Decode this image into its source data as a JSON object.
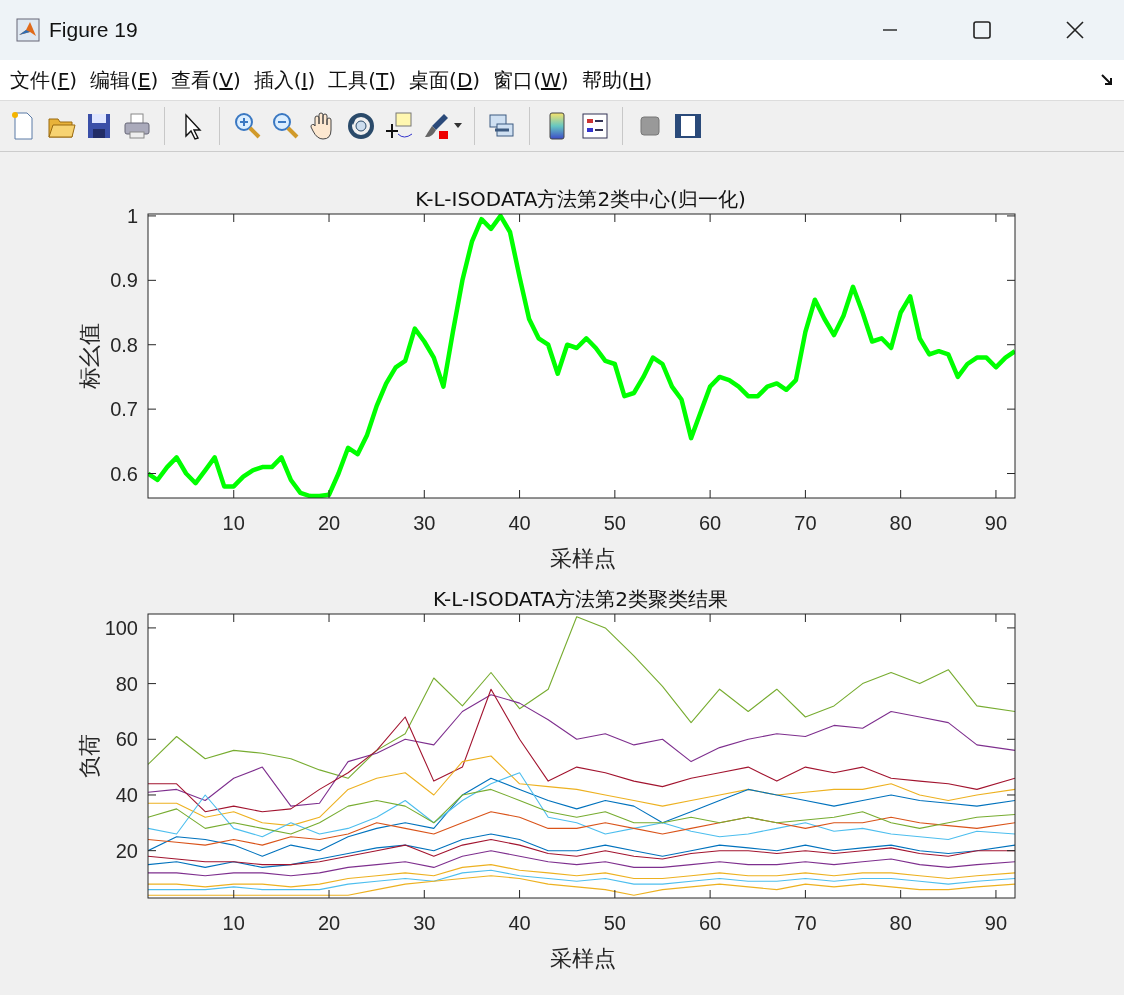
{
  "window": {
    "title": "Figure 19"
  },
  "menu": [
    "文件(F)",
    "编辑(E)",
    "查看(V)",
    "插入(I)",
    "工具(T)",
    "桌面(D)",
    "窗口(W)",
    "帮助(H)"
  ],
  "axes": [
    {
      "chart_data": {
        "type": "line",
        "title": "K-L-ISODATA方法第2类中心(归一化)",
        "xlabel": "采样点",
        "ylabel": "标幺值",
        "x": [
          1,
          2,
          3,
          4,
          5,
          6,
          7,
          8,
          9,
          10,
          11,
          12,
          13,
          14,
          15,
          16,
          17,
          18,
          19,
          20,
          21,
          22,
          23,
          24,
          25,
          26,
          27,
          28,
          29,
          30,
          31,
          32,
          33,
          34,
          35,
          36,
          37,
          38,
          39,
          40,
          41,
          42,
          43,
          44,
          45,
          46,
          47,
          48,
          49,
          50,
          51,
          52,
          53,
          54,
          55,
          56,
          57,
          58,
          59,
          60,
          61,
          62,
          63,
          64,
          65,
          66,
          67,
          68,
          69,
          70,
          71,
          72,
          73,
          74,
          75,
          76,
          77,
          78,
          79,
          80,
          81,
          82,
          83,
          84,
          85,
          86,
          87,
          88,
          89,
          90,
          91,
          92
        ],
        "xlim": [
          1,
          92
        ],
        "ylim": [
          0.562,
          1.003
        ],
        "xticks": [
          10,
          20,
          30,
          40,
          50,
          60,
          70,
          80,
          90
        ],
        "yticks": [
          0.6,
          0.7,
          0.8,
          0.9,
          1
        ],
        "series": [
          {
            "color": "#00ff00",
            "values": [
              0.6,
              0.59,
              0.61,
              0.625,
              0.6,
              0.585,
              0.605,
              0.625,
              0.58,
              0.58,
              0.595,
              0.605,
              0.61,
              0.61,
              0.625,
              0.59,
              0.57,
              0.565,
              0.565,
              0.567,
              0.6,
              0.64,
              0.63,
              0.66,
              0.705,
              0.74,
              0.765,
              0.775,
              0.825,
              0.805,
              0.78,
              0.735,
              0.82,
              0.9,
              0.96,
              0.995,
              0.98,
              1.0,
              0.975,
              0.905,
              0.84,
              0.81,
              0.8,
              0.755,
              0.8,
              0.795,
              0.81,
              0.795,
              0.775,
              0.77,
              0.72,
              0.725,
              0.75,
              0.78,
              0.77,
              0.735,
              0.715,
              0.655,
              0.695,
              0.735,
              0.75,
              0.745,
              0.735,
              0.72,
              0.72,
              0.735,
              0.74,
              0.73,
              0.745,
              0.82,
              0.87,
              0.84,
              0.815,
              0.845,
              0.89,
              0.85,
              0.805,
              0.81,
              0.795,
              0.85,
              0.875,
              0.81,
              0.785,
              0.79,
              0.785,
              0.75,
              0.77,
              0.78,
              0.78,
              0.765,
              0.78,
              0.79
            ]
          }
        ]
      }
    },
    {
      "chart_data": {
        "type": "line",
        "title": "K-L-ISODATA方法第2类聚类结果",
        "xlabel": "采样点",
        "ylabel": "负荷",
        "x": [
          1,
          4,
          7,
          10,
          13,
          16,
          19,
          22,
          25,
          28,
          31,
          34,
          37,
          40,
          43,
          46,
          49,
          52,
          55,
          58,
          61,
          64,
          67,
          70,
          73,
          76,
          79,
          82,
          85,
          88,
          92
        ],
        "xlim": [
          1,
          92
        ],
        "ylim": [
          3,
          105
        ],
        "xticks": [
          10,
          20,
          30,
          40,
          50,
          60,
          70,
          80,
          90
        ],
        "yticks": [
          20,
          40,
          60,
          80,
          100
        ],
        "series": [
          {
            "color": "#77ac30",
            "values": [
              51,
              61,
              53,
              56,
              55,
              53,
              49,
              46,
              56,
              62,
              82,
              72,
              84,
              71,
              78,
              104,
              100,
              90,
              79,
              66,
              78,
              70,
              78,
              68,
              72,
              80,
              84,
              80,
              85,
              72,
              70
            ]
          },
          {
            "color": "#7e2f8e",
            "values": [
              41,
              42,
              38,
              46,
              50,
              36,
              37,
              52,
              55,
              60,
              58,
              70,
              76,
              73,
              67,
              60,
              62,
              58,
              60,
              52,
              57,
              60,
              62,
              61,
              65,
              64,
              70,
              68,
              66,
              58,
              56
            ]
          },
          {
            "color": "#a2142f",
            "values": [
              44,
              44,
              34,
              36,
              34,
              35,
              42,
              48,
              56,
              68,
              45,
              50,
              78,
              60,
              45,
              50,
              48,
              45,
              43,
              46,
              48,
              50,
              45,
              50,
              48,
              50,
              46,
              45,
              44,
              42,
              46
            ]
          },
          {
            "color": "#edb120",
            "values": [
              37,
              37,
              32,
              34,
              30,
              29,
              32,
              42,
              46,
              48,
              40,
              52,
              54,
              44,
              43,
              42,
              40,
              38,
              36,
              38,
              40,
              42,
              40,
              41,
              42,
              42,
              44,
              40,
              38,
              40,
              42
            ]
          },
          {
            "color": "#0072bd",
            "values": [
              20,
              25,
              24,
              22,
              18,
              22,
              20,
              25,
              28,
              30,
              28,
              40,
              46,
              42,
              38,
              35,
              38,
              36,
              30,
              34,
              38,
              42,
              40,
              38,
              36,
              38,
              40,
              38,
              37,
              36,
              38
            ]
          },
          {
            "color": "#4dbeee",
            "values": [
              28,
              26,
              40,
              28,
              25,
              30,
              26,
              28,
              32,
              38,
              30,
              38,
              44,
              48,
              32,
              30,
              26,
              28,
              30,
              27,
              25,
              26,
              28,
              30,
              27,
              28,
              26,
              25,
              24,
              27,
              26
            ]
          },
          {
            "color": "#d95319",
            "values": [
              24,
              23,
              22,
              24,
              22,
              25,
              24,
              26,
              30,
              28,
              26,
              30,
              34,
              32,
              28,
              28,
              30,
              28,
              26,
              28,
              30,
              32,
              30,
              28,
              30,
              30,
              32,
              30,
              29,
              28,
              30
            ]
          },
          {
            "color": "#77ac30",
            "values": [
              32,
              35,
              28,
              30,
              28,
              26,
              30,
              36,
              38,
              36,
              30,
              40,
              42,
              38,
              34,
              32,
              34,
              30,
              30,
              32,
              30,
              32,
              30,
              31,
              32,
              34,
              30,
              28,
              30,
              32,
              33
            ]
          },
          {
            "color": "#0072bd",
            "values": [
              15,
              16,
              14,
              16,
              14,
              15,
              17,
              19,
              21,
              22,
              20,
              24,
              26,
              24,
              20,
              20,
              22,
              20,
              18,
              20,
              22,
              21,
              20,
              22,
              20,
              21,
              22,
              20,
              19,
              20,
              22
            ]
          },
          {
            "color": "#a2142f",
            "values": [
              18,
              17,
              16,
              16,
              15,
              15,
              16,
              18,
              20,
              22,
              18,
              22,
              24,
              22,
              19,
              18,
              20,
              18,
              17,
              19,
              20,
              20,
              19,
              20,
              19,
              20,
              21,
              19,
              18,
              20,
              20
            ]
          },
          {
            "color": "#7e2f8e",
            "values": [
              12,
              12,
              11,
              12,
              12,
              11,
              12,
              14,
              15,
              16,
              14,
              18,
              20,
              18,
              16,
              15,
              16,
              14,
              14,
              15,
              16,
              15,
              15,
              16,
              15,
              16,
              17,
              15,
              14,
              15,
              16
            ]
          },
          {
            "color": "#edb120",
            "values": [
              8,
              8,
              7,
              8,
              8,
              7,
              8,
              10,
              11,
              12,
              11,
              14,
              15,
              13,
              12,
              11,
              12,
              10,
              10,
              11,
              12,
              11,
              11,
              12,
              11,
              12,
              12,
              11,
              10,
              11,
              12
            ]
          },
          {
            "color": "#4dbeee",
            "values": [
              6,
              6,
              6,
              7,
              6,
              6,
              6,
              8,
              9,
              10,
              9,
              12,
              13,
              11,
              10,
              9,
              10,
              8,
              8,
              9,
              10,
              9,
              9,
              10,
              9,
              10,
              10,
              9,
              8,
              9,
              10
            ]
          },
          {
            "color": "#edb120",
            "values": [
              4,
              4,
              4,
              4,
              4,
              4,
              4,
              4,
              6,
              8,
              9,
              10,
              11,
              10,
              8,
              7,
              6,
              4,
              6,
              7,
              8,
              7,
              6,
              8,
              7,
              8,
              7,
              6,
              6,
              7,
              8
            ]
          }
        ]
      }
    }
  ]
}
